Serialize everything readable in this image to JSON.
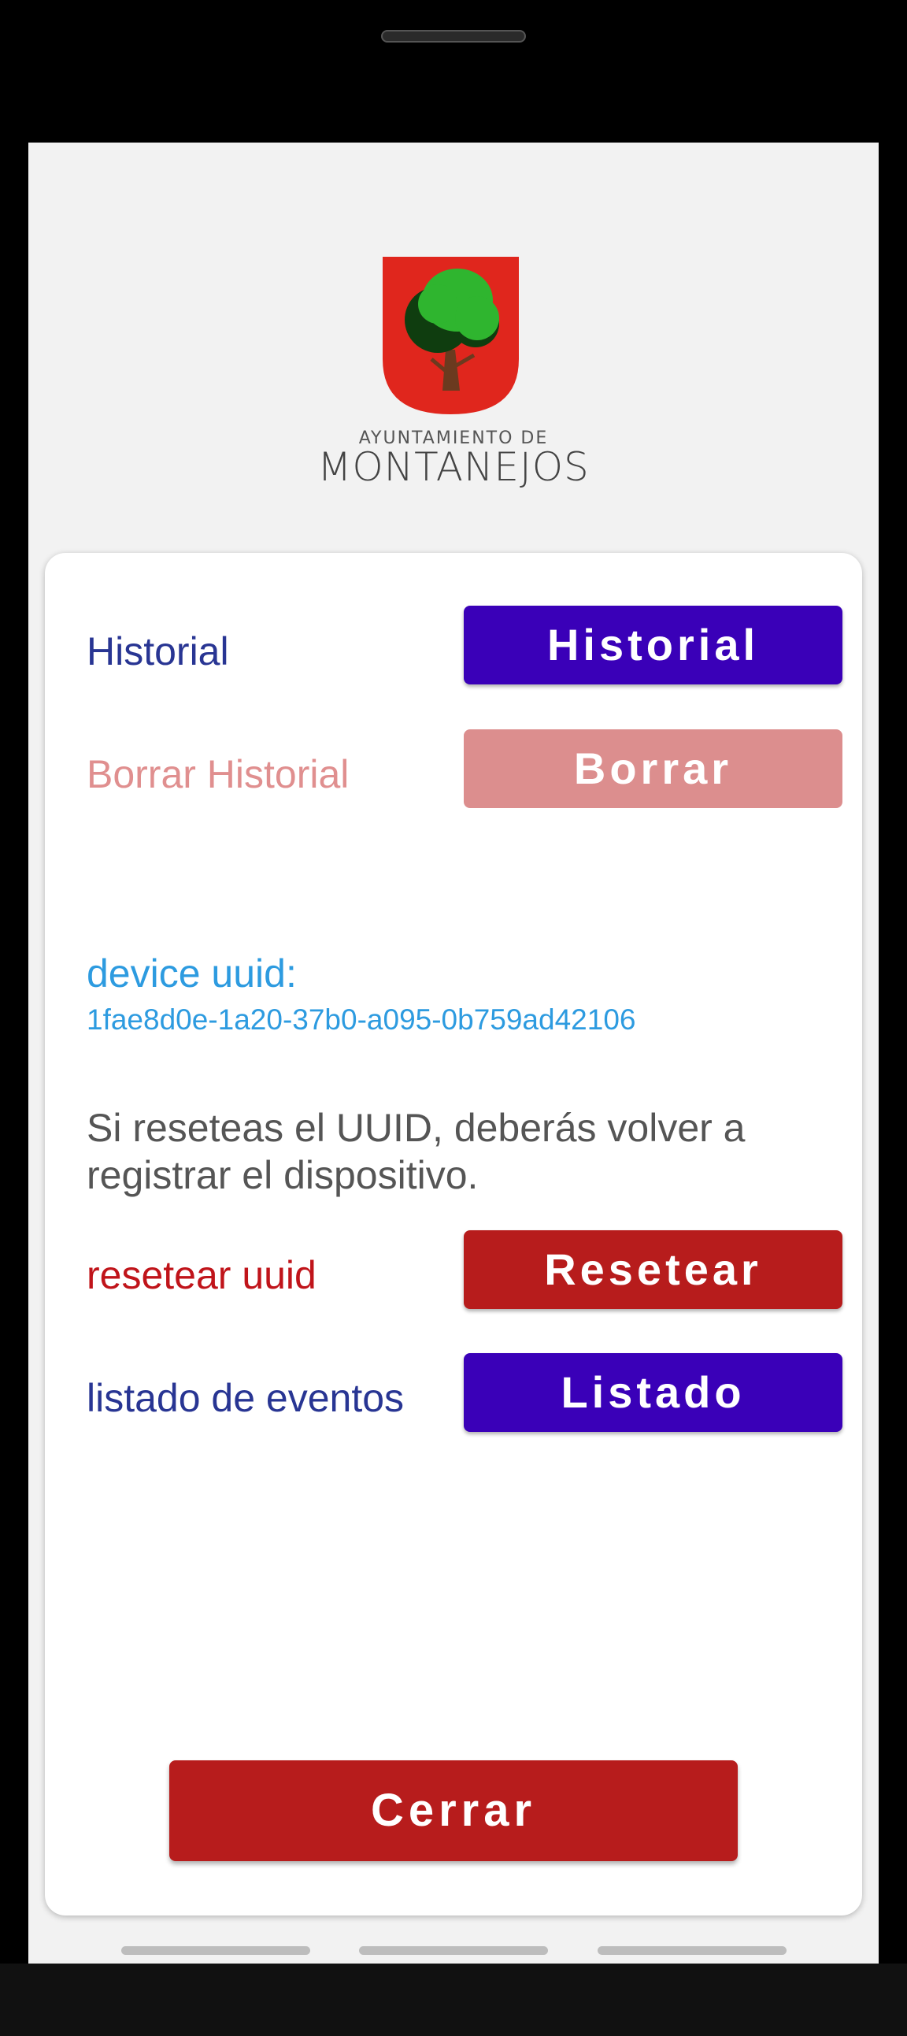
{
  "logo": {
    "subtitle": "AYUNTAMIENTO DE",
    "title": "MONTANEJOS"
  },
  "settings": {
    "historial": {
      "label": "Historial",
      "button": "Historial"
    },
    "borrar": {
      "label": "Borrar Historial",
      "button": "Borrar"
    },
    "device": {
      "label": "device uuid:",
      "value": "1fae8d0e-1a20-37b0-a095-0b759ad42106"
    },
    "warning": "Si reseteas el UUID, deberás volver a registrar el dispositivo.",
    "reset": {
      "label": "resetear uuid",
      "button": "Resetear"
    },
    "listado": {
      "label": "listado de eventos",
      "button": "Listado"
    }
  },
  "footer": {
    "close_button": "Cerrar"
  },
  "colors": {
    "primary": "#3a00b8",
    "danger": "#b71c1c",
    "danger_disabled": "#dc8e8e",
    "link_blue": "#2d9be0",
    "label_blue": "#283593"
  },
  "icons": {
    "logo": "coat-of-arms-tree-icon"
  }
}
